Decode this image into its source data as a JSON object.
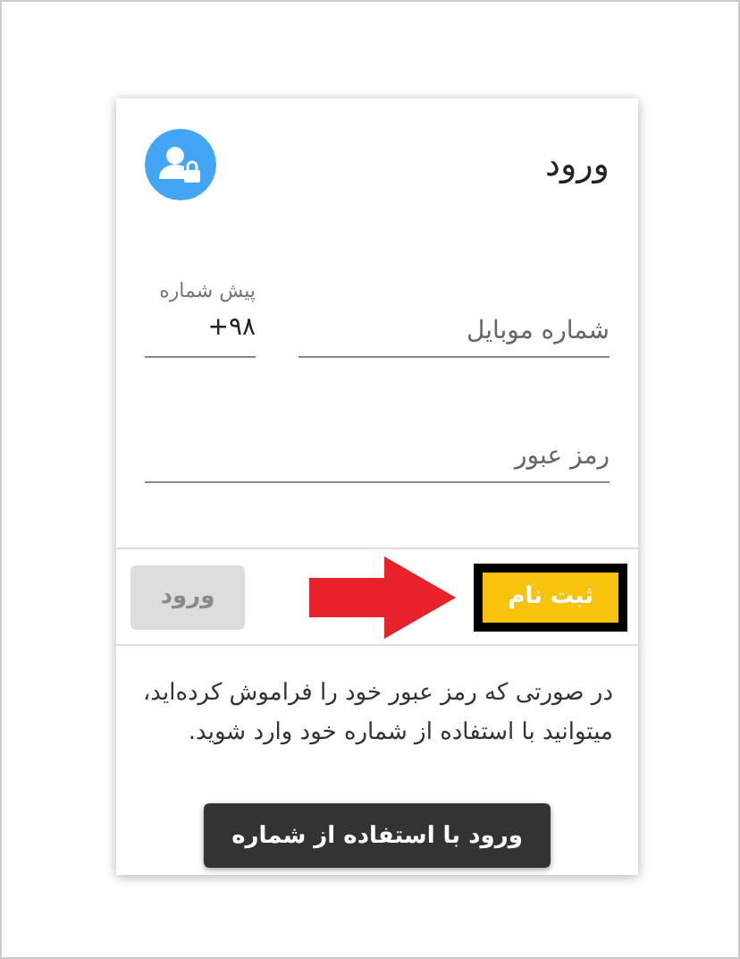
{
  "card": {
    "title": "ورود"
  },
  "fields": [
    {
      "kind": "prefix",
      "label": "پیش شماره",
      "value": "+۹۸"
    },
    {
      "kind": "phone",
      "placeholder": "شماره موبایل"
    },
    {
      "kind": "password",
      "placeholder": "رمز عبور"
    }
  ],
  "actions": [
    {
      "label": "ثبت نام",
      "kind": "primary",
      "highlighted": true,
      "disabled": false
    },
    {
      "label": "ورود",
      "kind": "secondary",
      "highlighted": false,
      "disabled": true
    }
  ],
  "pointer_arrow": true,
  "help_text": "در صورتی که رمز عبور خود را فراموش کرده‌اید، میتوانید با استفاده از شماره خود وارد شوید.",
  "otp_button": {
    "label": "ورود با استفاده از شماره"
  }
}
